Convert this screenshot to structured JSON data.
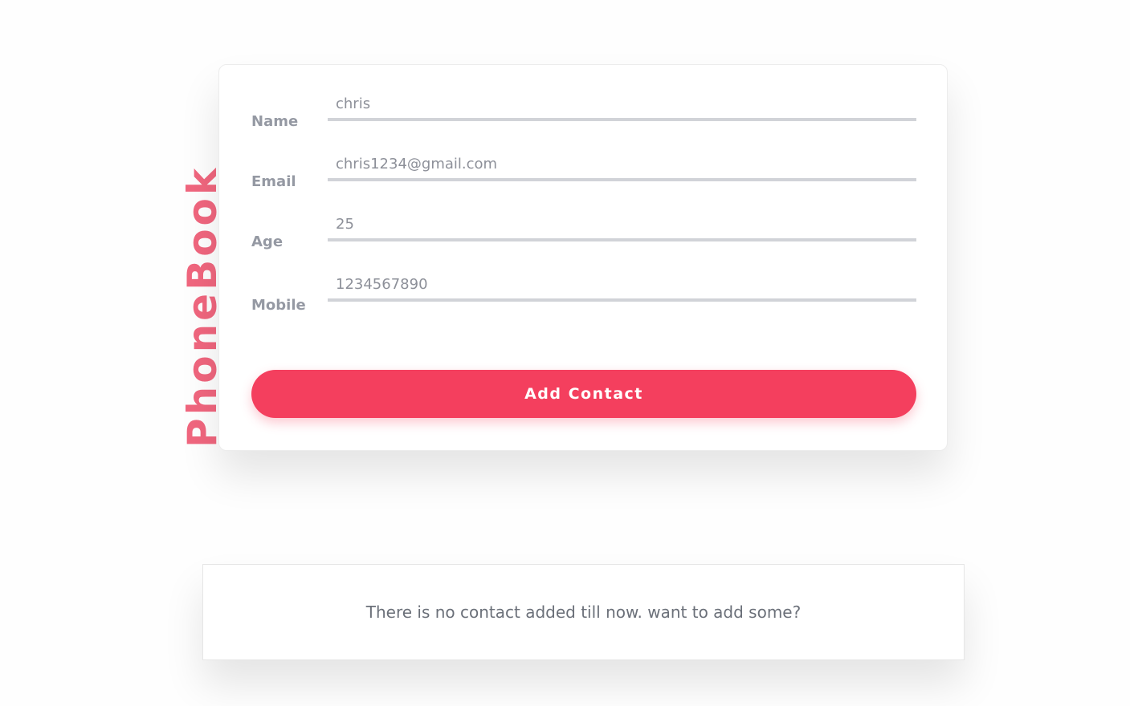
{
  "brand": {
    "title": "PhoneBook",
    "color": "#f0667e"
  },
  "form": {
    "fields": [
      {
        "label": "Name",
        "value": "chris"
      },
      {
        "label": "Email",
        "value": "chris1234@gmail.com"
      },
      {
        "label": "Age",
        "value": "25"
      },
      {
        "label": "Mobile",
        "value": "1234567890"
      }
    ],
    "submit_label": "Add Contact",
    "accent_color": "#f43f5e"
  },
  "contacts": {
    "empty_message": "There is no contact added till now. want to add some?"
  }
}
